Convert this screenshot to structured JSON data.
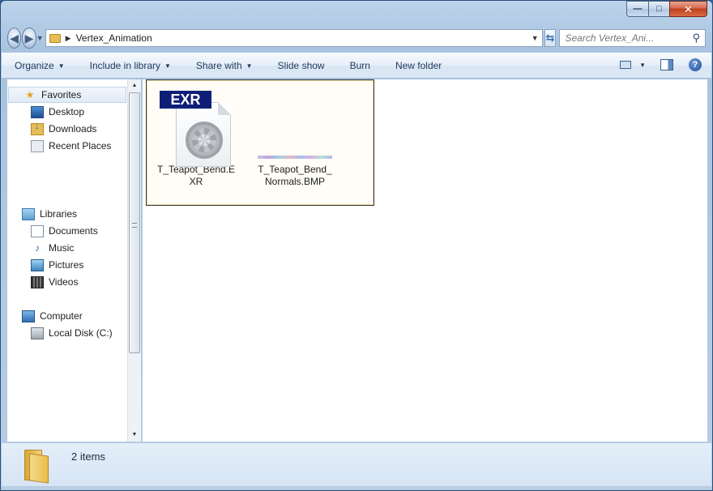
{
  "window": {
    "caption": {
      "minimize": "—",
      "maximize": "□",
      "close": "✕"
    }
  },
  "navigation": {
    "back_icon": "arrow-left-icon",
    "forward_icon": "arrow-right-icon",
    "address_path": "Vertex_Animation",
    "search_placeholder": "Search Vertex_Ani...",
    "search_icon": "magnifier-icon"
  },
  "toolbar": {
    "organize": "Organize",
    "include_in_library": "Include in library",
    "share_with": "Share with",
    "slide_show": "Slide show",
    "burn": "Burn",
    "new_folder": "New folder",
    "help_glyph": "?"
  },
  "nav_pane": {
    "favorites": "Favorites",
    "desktop": "Desktop",
    "downloads": "Downloads",
    "recent_places": "Recent Places",
    "libraries": "Libraries",
    "documents": "Documents",
    "music": "Music",
    "pictures": "Pictures",
    "videos": "Videos",
    "computer": "Computer",
    "local_disk": "Local Disk (C:)"
  },
  "files": [
    {
      "name": "T_Teapot_Bend.EXR",
      "badge": "EXR"
    },
    {
      "name": "T_Teapot_Bend_Normals.BMP"
    }
  ],
  "status": {
    "item_count": "2 items"
  }
}
